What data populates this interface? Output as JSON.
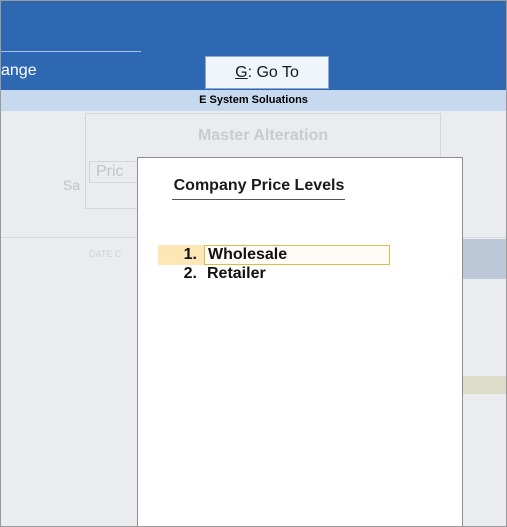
{
  "topbar": {
    "change_text": "ange",
    "goto_key": "G",
    "goto_rest": ": Go To"
  },
  "company_name": "E System Soluations",
  "background": {
    "master_title": "Master Alteration",
    "price_field": "Pric",
    "sa_label": "Sa",
    "date_col": "DATE C"
  },
  "popup": {
    "title": "Company Price Levels",
    "items": [
      {
        "number": "1.",
        "label": "Wholesale",
        "selected": true
      },
      {
        "number": "2.",
        "label": "Retailer",
        "selected": false
      }
    ]
  },
  "colors": {
    "topbar": "#2e68b3",
    "company_bar": "#c6d9ef",
    "selected_number_bg": "#fde7b5",
    "selected_border": "#e1b94a"
  }
}
